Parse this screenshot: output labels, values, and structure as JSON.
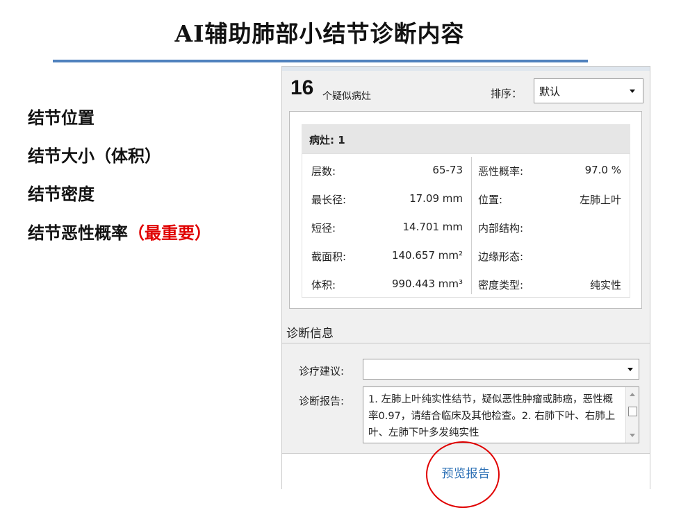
{
  "slide": {
    "title": "AI辅助肺部小结节诊断内容",
    "bullets": [
      {
        "text": "结节位置",
        "highlight": ""
      },
      {
        "text": "结节大小（体积）",
        "highlight": ""
      },
      {
        "text": "结节密度",
        "highlight": ""
      },
      {
        "text": "结节恶性概率",
        "highlight": "（最重要）"
      }
    ],
    "highlight_color": "#e00000",
    "rule_color": "#4f81bd"
  },
  "panel": {
    "count": "16",
    "count_label": "个疑似病灶",
    "sort_label": "排序：",
    "sort_value": "默认",
    "lesion": {
      "title": "病灶: 1",
      "left_rows": [
        {
          "label": "层数:",
          "value": "65-73"
        },
        {
          "label": "最长径:",
          "value": "17.09 mm"
        },
        {
          "label": "短径:",
          "value": "14.701 mm"
        },
        {
          "label": "截面积:",
          "value": "140.657 mm²"
        },
        {
          "label": "体积:",
          "value": "990.443 mm³"
        }
      ],
      "right_rows": [
        {
          "label": "恶性概率:",
          "value": "97.0 %"
        },
        {
          "label": "位置:",
          "value": "左肺上叶"
        },
        {
          "label": "内部结构:",
          "value": ""
        },
        {
          "label": "边缘形态:",
          "value": ""
        },
        {
          "label": "密度类型:",
          "value": "纯实性"
        }
      ]
    },
    "diagnosis": {
      "title": "诊断信息",
      "advice_label": "诊疗建议:",
      "advice_value": "",
      "report_label": "诊断报告:",
      "report_text": "1. 左肺上叶纯实性结节，疑似恶性肿瘤或肺癌，恶性概率0.97，请结合临床及其他检查。2. 右肺下叶、右肺上叶、左肺下叶多发纯实性"
    },
    "preview_button": "预览报告",
    "link_color": "#2a6fb5"
  }
}
